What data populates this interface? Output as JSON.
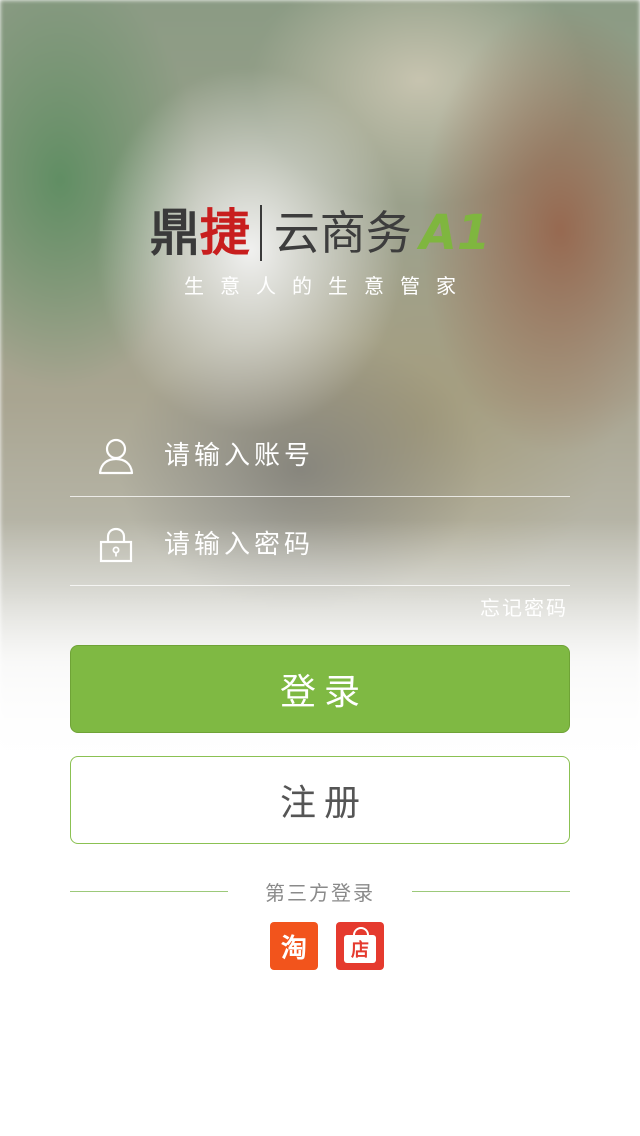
{
  "brand": {
    "part1": "鼎",
    "part2": "捷",
    "part3": "云商务",
    "part4": "A1",
    "tagline": "生意人的生意管家",
    "colors": {
      "dark": "#3a3a3a",
      "red": "#c81e1e",
      "green": "#7fb63f"
    }
  },
  "login_form": {
    "account_placeholder": "请输入账号",
    "account_icon": "user-icon",
    "password_placeholder": "请输入密码",
    "password_icon": "lock-icon",
    "forgot_password": "忘记密码"
  },
  "buttons": {
    "login": "登录",
    "register": "注册",
    "login_color": "#7fb943"
  },
  "third_party": {
    "label": "第三方登录",
    "providers": [
      {
        "name": "taobao-icon",
        "glyph": "淘",
        "color": "#f2541c"
      },
      {
        "name": "shop-icon",
        "glyph": "店",
        "color": "#e53a2e"
      }
    ]
  }
}
